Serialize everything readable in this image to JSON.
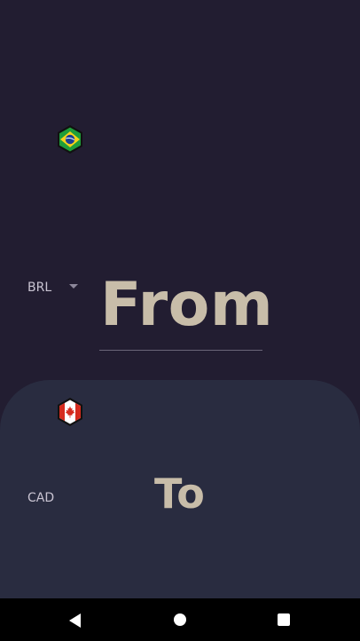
{
  "from": {
    "currency_code": "BRL",
    "amount_placeholder": "From",
    "flag_icon": "brazil-flag-icon",
    "dropdown_icon": "dropdown-arrow-icon"
  },
  "to": {
    "currency_code": "CAD",
    "amount_placeholder": "To",
    "flag_icon": "canada-flag-icon"
  },
  "navigation_bar": {
    "back_icon": "back-triangle-icon",
    "home_icon": "home-circle-icon",
    "recents_icon": "recents-square-icon"
  },
  "colors": {
    "background": "#221d31",
    "to_panel": "#292c40",
    "amount_text": "#c8bda9",
    "label_text": "#c9c4d2",
    "nav_bar": "#000000"
  }
}
